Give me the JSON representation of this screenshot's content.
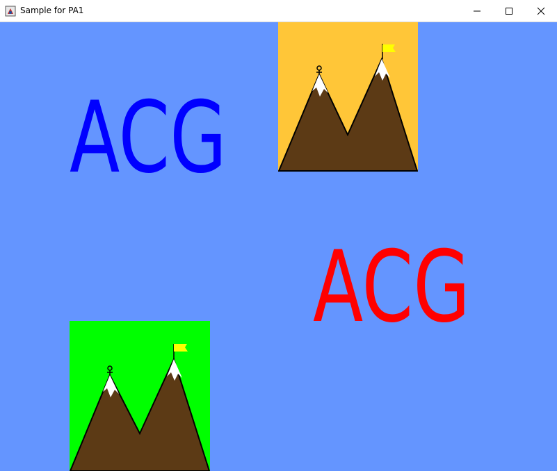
{
  "window": {
    "title": "Sample for PA1"
  },
  "colors": {
    "background": "#6495ff",
    "logo_blue": "#0000ff",
    "logo_red": "#ff0000",
    "sky_orange": "#ffc638",
    "sky_green": "#00ff00",
    "mountain": "#5c3a15",
    "snow": "#ffffff",
    "flag": "#ffff00"
  },
  "logos": [
    {
      "text": "ACG",
      "color": "blue"
    },
    {
      "text": "ACG",
      "color": "red"
    }
  ],
  "scenes": [
    {
      "sky": "orange",
      "icons": [
        "mountain-icon",
        "flag-icon",
        "climber-icon"
      ]
    },
    {
      "sky": "green",
      "icons": [
        "mountain-icon",
        "flag-icon",
        "climber-icon"
      ]
    }
  ]
}
